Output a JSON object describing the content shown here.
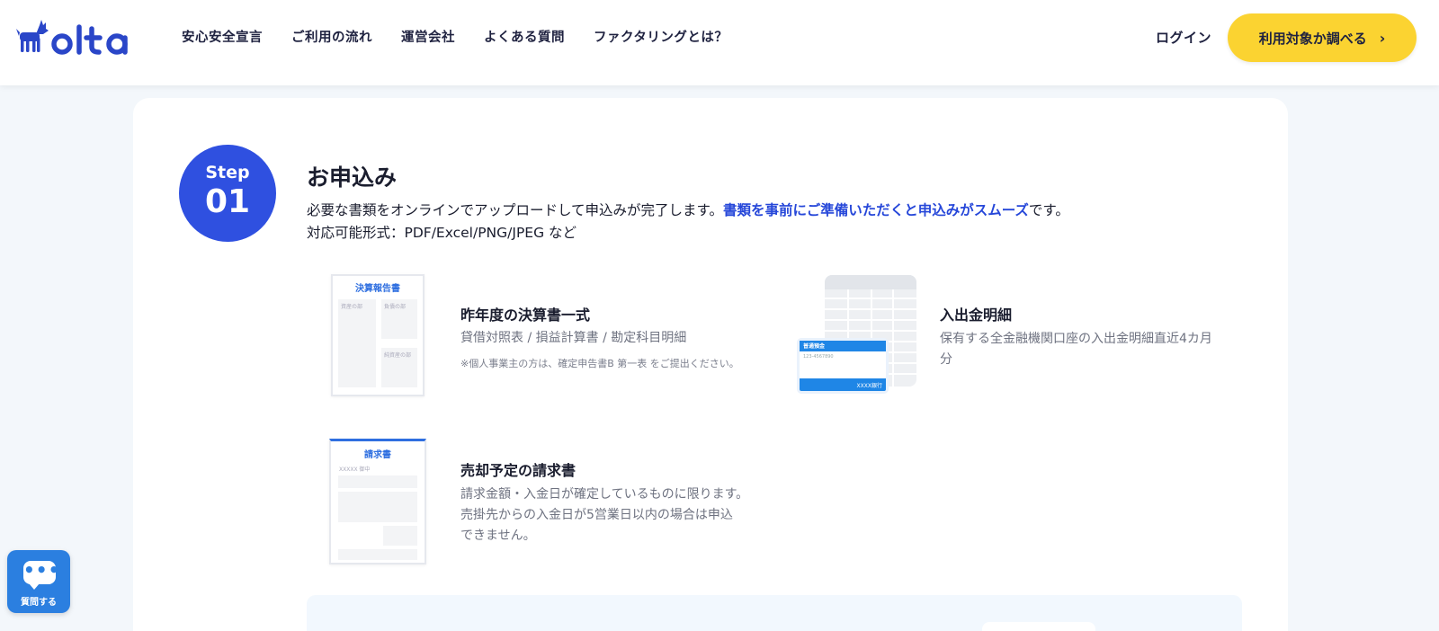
{
  "header": {
    "logo_text": "olta",
    "nav": [
      {
        "label": "安心安全宣言"
      },
      {
        "label": "ご利用の流れ"
      },
      {
        "label": "運営会社"
      },
      {
        "label": "よくある質問"
      },
      {
        "label": "ファクタリングとは？"
      }
    ],
    "login_label": "ログイン",
    "cta_label": "利用対象か調べる",
    "cta_icon": "chevron-right-icon"
  },
  "step": {
    "label": "Step",
    "number": "01",
    "title": "お申込み",
    "desc_line1_a": "必要な書類をオンラインでアップロードして申込みが完了します。",
    "desc_line1_highlight": "書類を事前にご準備いただくと申込みがスムーズ",
    "desc_line1_b": "です。",
    "desc_line2": "対応可能形式：PDF/Excel/PNG/JPEG など"
  },
  "items": [
    {
      "thumb_title": "決算報告書",
      "thumb_label_a": "資産の部",
      "thumb_label_b": "負債の部",
      "thumb_label_c": "純資産の部",
      "title": "昨年度の決算書一式",
      "text": "貸借対照表 / 損益計算書 / 勘定科目明細",
      "note": "※個人事業主の方は、確定申告書B 第一表 をご提出ください。"
    },
    {
      "thumb_card_label": "普通預金",
      "thumb_card_number": "123-4567890",
      "thumb_card_bank": "XXXX銀行",
      "title": "入出金明細",
      "text_line1": "保有する全金融機関口座の入出金明細直近4カ月",
      "text_line2": "分"
    },
    {
      "thumb_title": "請求書",
      "thumb_addressee": "XXXXX 御中",
      "title": "売却予定の請求書",
      "text_line1": "請求金額・入金日が確定しているものに限ります。",
      "text_line2": "売掛先からの入金日が5営業日以内の場合は申込",
      "text_line3": "できません。"
    }
  ],
  "chat": {
    "icon": "chat-bubble-icon",
    "label": "質問する"
  },
  "colors": {
    "brand_blue": "#2f50e0",
    "highlight": "#2647d9",
    "cta_yellow": "#fbd331",
    "chat_blue": "#2b7fe0"
  }
}
